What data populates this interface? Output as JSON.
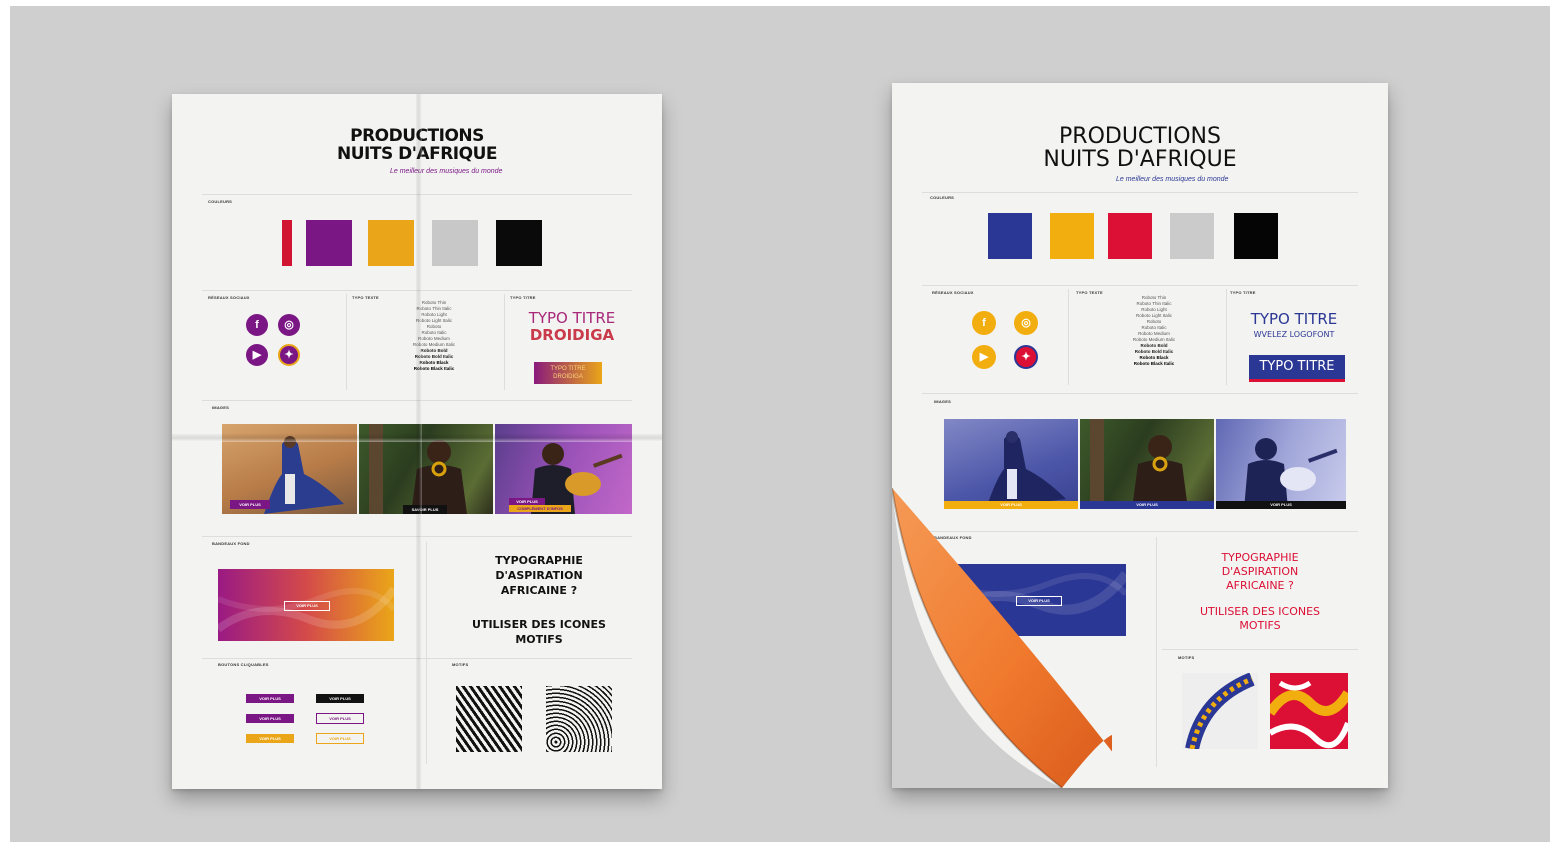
{
  "colors": {
    "left_swatches": [
      "#d21433",
      "#7b1785",
      "#eaa618",
      "#c8c8c8",
      "#0a0a0a"
    ],
    "right_swatches": [
      "#2b3795",
      "#f2ae0e",
      "#dc0f35",
      "#cbcbcb",
      "#050505"
    ],
    "purple": "#7b1785",
    "orange": "#eaa618",
    "blue": "#2b3795",
    "red": "#dc0f35",
    "curl": "#f07a2e"
  },
  "left_sheet": {
    "title_line1": "PRODUCTIONS",
    "title_line2": "NUITS D'AFRIQUE",
    "tagline": "Le meilleur des musiques du monde",
    "sec_colors": "COULEURS",
    "sec_social": "RÉSEAUX SOCIAUX",
    "sec_type_text": "TYPO TEXTE",
    "sec_type_title": "TYPO TITRE",
    "sec_images": "IMAGES",
    "sec_banner": "BANDEAUX FOND",
    "sec_buttons": "BOUTONS CLIQUABLES",
    "sec_motifs": "MOTIFS",
    "social_icons": [
      "facebook-icon",
      "instagram-icon",
      "youtube-icon",
      "twitter-icon"
    ],
    "font_weights": [
      "Roboto Thin",
      "Roboto Thin Italic",
      "Roboto Light",
      "Roboto Light Italic",
      "Roboto",
      "Roboto Italic",
      "Roboto Medium",
      "Roboto Medium Italic",
      "Roboto Bold",
      "Roboto Bold Italic",
      "Roboto Black",
      "Roboto Black Italic"
    ],
    "typo_line1": "TYPO TITRE",
    "typo_line2": "DROIDIGA",
    "typo_box_line1": "TYPO TITRE",
    "typo_box_line2": "DROIDIGA",
    "photo_labels": [
      "VOIR PLUS",
      "SAVOIR PLUS",
      "VOIR PLUS"
    ],
    "photo_label_extra": "COMPLÉMENT D'INFOS",
    "banner_button": "VOIR PLUS",
    "buttons": [
      "VOIR PLUS",
      "VOIR PLUS",
      "VOIR PLUS",
      "VOIR PLUS",
      "VOIR PLUS",
      "VOIR PLUS"
    ],
    "question1_line1": "TYPOGRAPHIE",
    "question1_line2": "D'ASPIRATION",
    "question1_line3": "AFRICAINE ?",
    "question2_line1": "UTILISER DES ICONES",
    "question2_line2": "MOTIFS"
  },
  "right_sheet": {
    "title_line1": "PRODUCTIONS",
    "title_line2": "NUITS D'AFRIQUE",
    "tagline": "Le meilleur des musiques du monde",
    "sec_colors": "COULEURS",
    "sec_social": "RÉSEAUX SOCIAUX",
    "sec_type_text": "TYPO TEXTE",
    "sec_type_title": "TYPO TITRE",
    "sec_images": "IMAGES",
    "sec_banner": "BANDEAUX FOND",
    "sec_motifs": "MOTIFS",
    "social_icons": [
      "facebook-icon",
      "instagram-icon",
      "youtube-icon",
      "twitter-icon"
    ],
    "font_weights": [
      "Roboto Thin",
      "Roboto Thin Italic",
      "Roboto Light",
      "Roboto Light Italic",
      "Roboto",
      "Roboto Italic",
      "Roboto Medium",
      "Roboto Medium Italic",
      "Roboto Bold",
      "Roboto Bold Italic",
      "Roboto Black",
      "Roboto Black Italic"
    ],
    "typo_line1": "TYPO TITRE",
    "typo_line2": "WVELEZ LOGOFONT",
    "typo_box": "TYPO TITRE",
    "photo_labels": [
      "VOIR PLUS",
      "VOIR PLUS",
      "VOIR PLUS"
    ],
    "banner_button": "VOIR PLUS",
    "question1_line1": "TYPOGRAPHIE",
    "question1_line2": "D'ASPIRATION",
    "question1_line3": "AFRICAINE ?",
    "question2_line1": "UTILISER DES ICONES",
    "question2_line2": "MOTIFS"
  }
}
